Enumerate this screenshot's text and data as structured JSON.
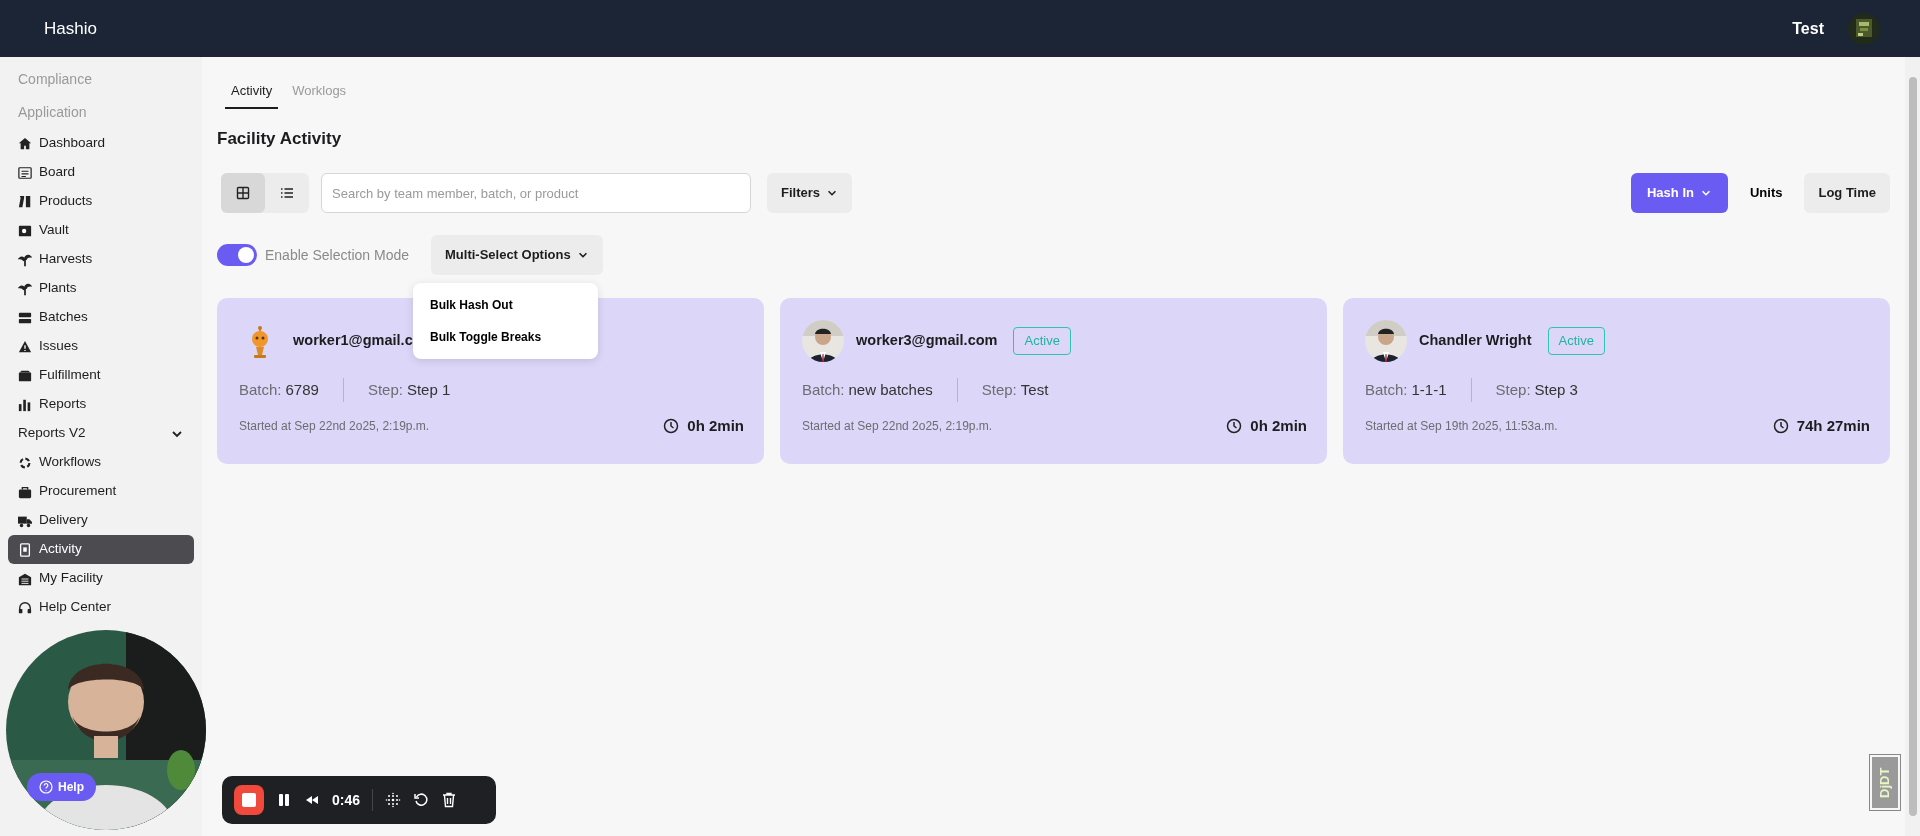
{
  "header": {
    "brand": "Hashio",
    "user": "Test"
  },
  "sidebar": {
    "items": [
      {
        "kind": "section",
        "label": "Compliance"
      },
      {
        "kind": "section",
        "label": "Application"
      },
      {
        "kind": "link",
        "label": "Dashboard",
        "selected": false
      },
      {
        "kind": "link",
        "label": "Board",
        "selected": false
      },
      {
        "kind": "link",
        "label": "Products",
        "selected": false
      },
      {
        "kind": "link",
        "label": "Vault",
        "selected": false
      },
      {
        "kind": "link",
        "label": "Harvests",
        "selected": false
      },
      {
        "kind": "link",
        "label": "Plants",
        "selected": false
      },
      {
        "kind": "link",
        "label": "Batches",
        "selected": false
      },
      {
        "kind": "link",
        "label": "Issues",
        "selected": false
      },
      {
        "kind": "link",
        "label": "Fulfillment",
        "selected": false
      },
      {
        "kind": "link",
        "label": "Reports",
        "selected": false
      },
      {
        "kind": "group",
        "label": "Reports V2",
        "selected": false
      },
      {
        "kind": "link",
        "label": "Workflows",
        "selected": false
      },
      {
        "kind": "link",
        "label": "Procurement",
        "selected": false
      },
      {
        "kind": "link",
        "label": "Delivery",
        "selected": false
      },
      {
        "kind": "link",
        "label": "Activity",
        "selected": true
      },
      {
        "kind": "link",
        "label": "My Facility",
        "selected": false
      },
      {
        "kind": "link",
        "label": "Help Center",
        "selected": false
      }
    ]
  },
  "tabs": [
    {
      "label": "Activity",
      "selected": true
    },
    {
      "label": "Worklogs",
      "selected": false
    }
  ],
  "title": "Facility Activity",
  "view_modes": [
    {
      "kind": "grid",
      "selected": true
    },
    {
      "kind": "list",
      "selected": false
    }
  ],
  "search": {
    "placeholder": "Search by team member, batch, or product"
  },
  "filters": "Filters",
  "actions": [
    {
      "kind": "primary",
      "label": "Hash In"
    },
    {
      "kind": "plain",
      "label": "Units"
    },
    {
      "kind": "secondary",
      "label": "Log Time"
    }
  ],
  "selection_mode": {
    "label": "Enable Selection Mode",
    "on": true
  },
  "multi_select": {
    "label": "Multi-Select Options",
    "menu": [
      "Bulk Hash Out",
      "Bulk Toggle Breaks"
    ]
  },
  "cards": [
    {
      "kind": "icon",
      "name": "worker1@gmail.c",
      "batch_label": "Batch:",
      "batch": "6789",
      "step_label": "Step:",
      "step": "Step 1",
      "started": "Started at Sep 22nd 2o25, 2:19p.m.",
      "duration": "0h 2min"
    },
    {
      "kind": "picture",
      "name": "worker3@gmail.com",
      "status": "Active",
      "batch_label": "Batch:",
      "batch": "new batches",
      "step_label": "Step:",
      "step": "Test",
      "started": "Started at Sep 22nd 2o25, 2:19p.m.",
      "duration": "0h 2min"
    },
    {
      "kind": "picture",
      "name": "Chandler Wright",
      "status": "Active",
      "batch_label": "Batch:",
      "batch": "1-1-1",
      "step_label": "Step:",
      "step": "Step 3",
      "started": "Started at Sep 19th 2o25, 11:53a.m.",
      "duration": "74h 27min"
    }
  ],
  "help": "Help",
  "recorder": {
    "time": "0:46"
  },
  "debug_badge": "DjDT"
}
